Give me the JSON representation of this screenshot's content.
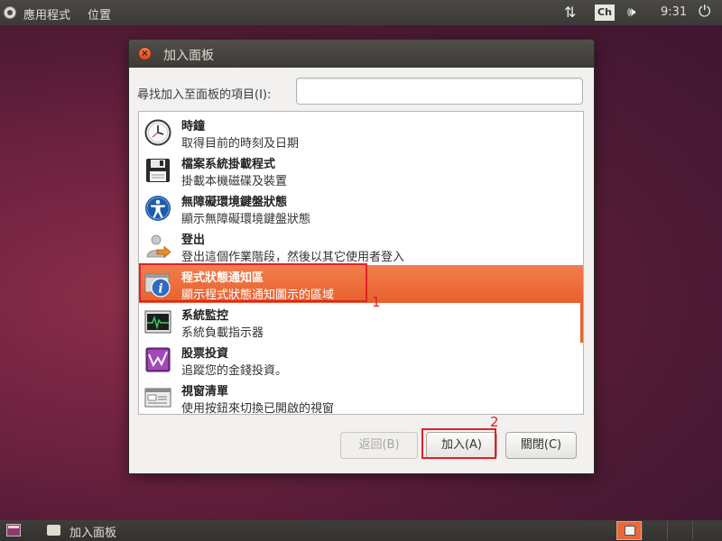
{
  "top_panel": {
    "apps_menu": "應用程式",
    "places_menu": "位置",
    "ime_label": "Ch",
    "clock": "9:31"
  },
  "dialog": {
    "title": "加入面板",
    "search_label": "尋找加入至面板的項目(I):",
    "search_value": "",
    "items": [
      {
        "title": "時鐘",
        "desc": "取得目前的時刻及日期",
        "icon": "clock-icon"
      },
      {
        "title": "檔案系統掛載程式",
        "desc": "掛載本機磁碟及裝置",
        "icon": "floppy-disk-icon"
      },
      {
        "title": "無障礙環境鍵盤狀態",
        "desc": "顯示無障礙環境鍵盤狀態",
        "icon": "accessibility-icon"
      },
      {
        "title": "登出",
        "desc": "登出這個作業階段，然後以其它使用者登入",
        "icon": "logout-icon"
      },
      {
        "title": "程式狀態通知區",
        "desc": "顯示程式狀態通知圖示的區域",
        "icon": "info-icon"
      },
      {
        "title": "系統監控",
        "desc": "系統負載指示器",
        "icon": "system-monitor-icon"
      },
      {
        "title": "股票投資",
        "desc": "追蹤您的金錢投資。",
        "icon": "stock-chart-icon"
      },
      {
        "title": "視窗清單",
        "desc": "使用按鈕來切換已開啟的視窗",
        "icon": "window-list-icon"
      }
    ],
    "selected_index": 4,
    "buttons": {
      "back": "返回(B)",
      "add": "加入(A)",
      "close": "關閉(C)"
    },
    "annotations": {
      "marker_1": "1",
      "marker_2": "2",
      "color": "#e0202a"
    },
    "selection_color": "#e8612d"
  },
  "bottom_panel": {
    "task_label": "加入面板"
  }
}
